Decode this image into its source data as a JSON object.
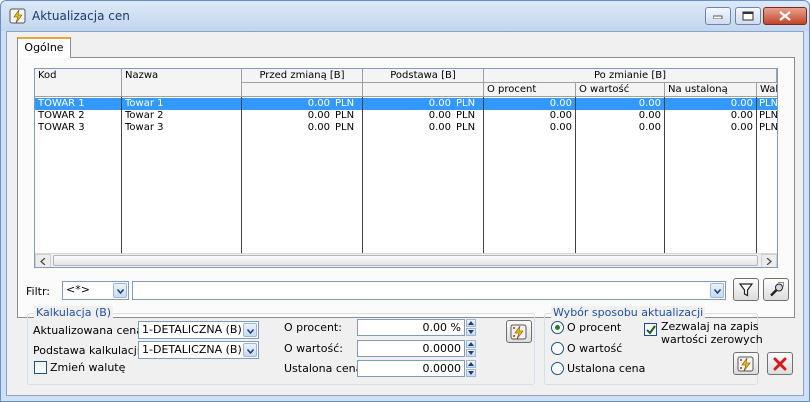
{
  "window": {
    "title": "Aktualizacja cen",
    "minimize_icon": "minimize-icon",
    "maximize_icon": "maximize-icon",
    "close_icon": "close-icon"
  },
  "tab": {
    "label": "Ogólne"
  },
  "grid": {
    "headers": {
      "kod": "Kod",
      "nazwa": "Nazwa",
      "przed": "Przed zmianą [B]",
      "podstawa": "Podstawa [B]",
      "po_zmianie": "Po zmianie [B]",
      "o_procent": "O procent",
      "o_wartosc": "O wartość",
      "na_ustalona": "Na ustaloną",
      "waluta": "Waluta"
    },
    "rows": [
      {
        "kod": "TOWAR 1",
        "nazwa": "Towar 1",
        "przed": "0.00",
        "przed_cur": "PLN",
        "podstawa": "0.00",
        "podstawa_cur": "PLN",
        "o_procent": "0.00",
        "o_wartosc": "0.00",
        "na_ustalona": "0.00",
        "waluta": "PLN",
        "selected": true
      },
      {
        "kod": "TOWAR 2",
        "nazwa": "Towar 2",
        "przed": "0.00",
        "przed_cur": "PLN",
        "podstawa": "0.00",
        "podstawa_cur": "PLN",
        "o_procent": "0.00",
        "o_wartosc": "0.00",
        "na_ustalona": "0.00",
        "waluta": "PLN",
        "selected": false
      },
      {
        "kod": "TOWAR 3",
        "nazwa": "Towar 3",
        "przed": "0.00",
        "przed_cur": "PLN",
        "podstawa": "0.00",
        "podstawa_cur": "PLN",
        "o_procent": "0.00",
        "o_wartosc": "0.00",
        "na_ustalona": "0.00",
        "waluta": "PLN",
        "selected": false
      }
    ]
  },
  "filter": {
    "label": "Filtr:",
    "mode_value": "<*>",
    "text_value": "",
    "funnel_icon": "funnel-icon",
    "tools_icon": "wrench-icon"
  },
  "kalkulacja": {
    "title": "Kalkulacja (B)",
    "aktualizowana_label": "Aktualizowana cena:",
    "aktualizowana_value": "1-DETALICZNA (B)",
    "podstawa_label": "Podstawa kalkulacji:",
    "podstawa_value": "1-DETALICZNA (B)",
    "zmien_walute_label": "Zmień walutę",
    "zmien_walute_checked": false,
    "o_procent_label": "O procent:",
    "o_procent_value": "0.00 %",
    "o_wartosc_label": "O wartość:",
    "o_wartosc_value": "0.0000",
    "ustalona_label": "Ustalona cena",
    "ustalona_value": "0.0000",
    "run_icon": "lightning-run-icon"
  },
  "wybor": {
    "title": "Wybór sposobu aktualizacji",
    "options": [
      "O procent",
      "O wartość",
      "Ustalona cena"
    ],
    "selected": "O procent",
    "zezwalaj_label_1": "Zezwalaj na zapis",
    "zezwalaj_label_2": "wartości zerowych",
    "zezwalaj_checked": true
  },
  "footer": {
    "confirm_icon": "lightning-confirm-icon",
    "cancel_icon": "cancel-x-icon"
  },
  "colors": {
    "selection": "#3399ff",
    "group_title": "#1e4f9e",
    "cancel_red": "#d61a1a"
  }
}
